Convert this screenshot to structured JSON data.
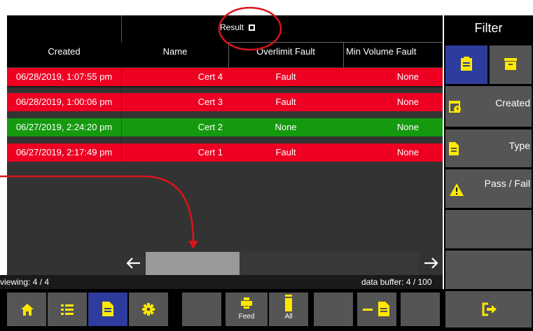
{
  "header": {
    "result_label": "Result",
    "result_icon": "square-bullet-icon"
  },
  "columns": [
    "Created",
    "Name",
    "Overlimit Fault",
    "Min Volume Fault"
  ],
  "rows": [
    {
      "created": "06/28/2019, 1:07:55 pm",
      "name": "Cert 4",
      "overlimit": "Fault",
      "minvol": "None",
      "status_color": "#ee0022"
    },
    {
      "created": "06/28/2019, 1:00:06 pm",
      "name": "Cert 3",
      "overlimit": "Fault",
      "minvol": "None",
      "status_color": "#ee0022"
    },
    {
      "created": "06/27/2019, 2:24:20 pm",
      "name": "Cert 2",
      "overlimit": "None",
      "minvol": "None",
      "status_color": "#159a0f"
    },
    {
      "created": "06/27/2019, 2:17:49 pm",
      "name": "Cert 1",
      "overlimit": "Fault",
      "minvol": "None",
      "status_color": "#ee0022"
    }
  ],
  "status": {
    "viewing": "viewing: 4 / 4",
    "buffer": "data buffer: 4 / 100"
  },
  "filter": {
    "title": "Filter",
    "created": "Created",
    "type": "Type",
    "pass_fail": "Pass / Fail"
  },
  "toolbar": {
    "feed": "Feed",
    "all": "All"
  },
  "colors": {
    "fault_red": "#ee0022",
    "pass_green": "#159a0f",
    "icon_yellow": "#ffe800",
    "selected_blue": "#2e3c9e",
    "annotation_red": "#d8141c"
  }
}
